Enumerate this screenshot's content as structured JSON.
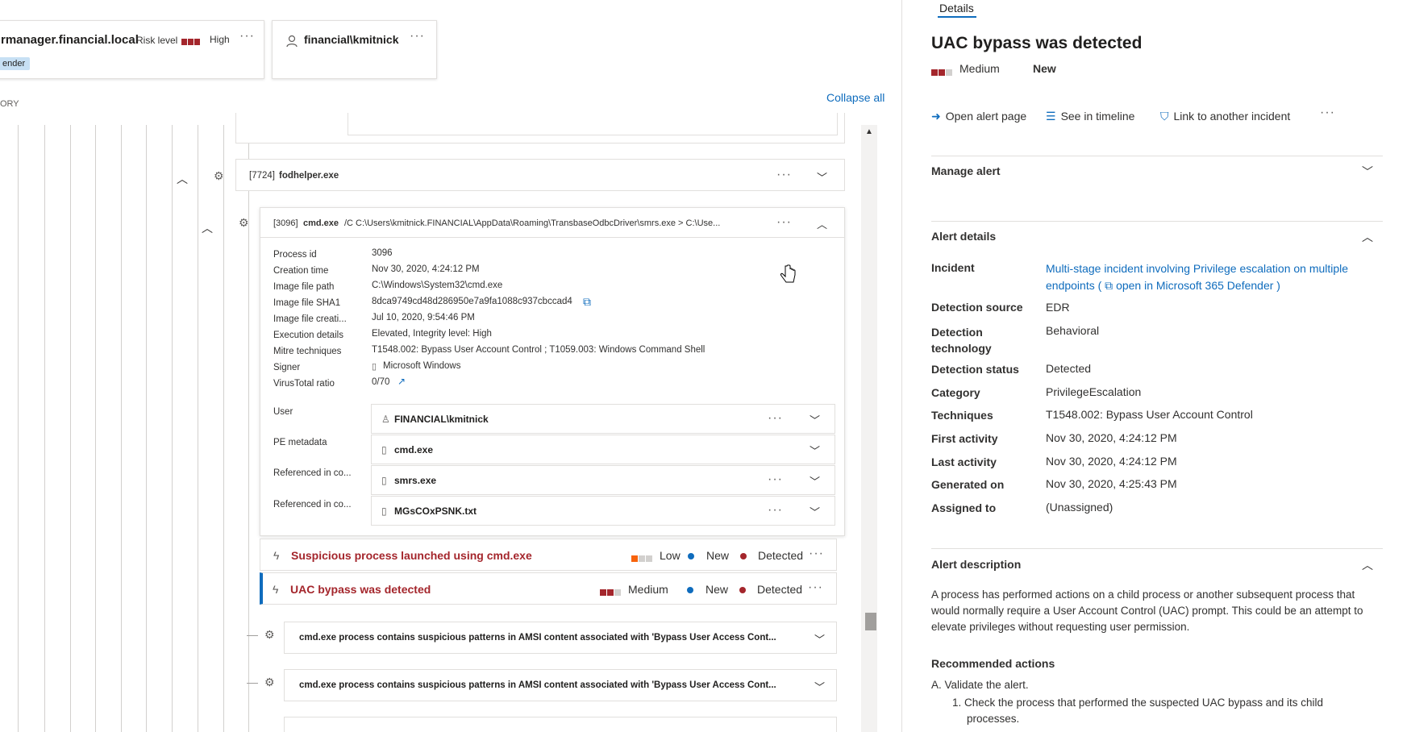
{
  "left": {
    "device_card": {
      "name": "rmanager.financial.local",
      "risk_label": "Risk level",
      "risk_value": "High",
      "tag": "ender",
      "more": "···"
    },
    "user_card": {
      "name": "financial\\kmitnick",
      "more": "···"
    },
    "section_partial": "ORY",
    "collapse_all": "Collapse all",
    "fodhelper": {
      "pid": "[7724]",
      "name": "fodhelper.exe",
      "more": "···"
    },
    "cmd_process": {
      "pid": "[3096]",
      "name": "cmd.exe",
      "args": "/C C:\\Users\\kmitnick.FINANCIAL\\AppData\\Roaming\\TransbaseOdbcDriver\\smrs.exe > C:\\Use...",
      "more": "···"
    },
    "details": [
      {
        "label": "Process id",
        "value": "3096"
      },
      {
        "label": "Creation time",
        "value": "Nov 30, 2020, 4:24:12 PM"
      },
      {
        "label": "Image file path",
        "value": "C:\\Windows\\System32\\cmd.exe"
      },
      {
        "label": "Image file SHA1",
        "value": "8dca9749cd48d286950e7a9fa1088c937cbccad4"
      },
      {
        "label": "Image file creati...",
        "value": "Jul 10, 2020, 9:54:46 PM"
      },
      {
        "label": "Execution details",
        "value": "Elevated, Integrity level: High"
      },
      {
        "label": "Mitre techniques",
        "value": "T1548.002: Bypass User Account Control ; T1059.003: Windows Command Shell"
      },
      {
        "label": "Signer",
        "value": "Microsoft Windows"
      },
      {
        "label": "VirusTotal ratio",
        "value": "0/70"
      }
    ],
    "subrows": [
      {
        "label": "User",
        "value": "FINANCIAL\\kmitnick",
        "icon": "user-icon",
        "dots": "···"
      },
      {
        "label": "PE metadata",
        "value": "cmd.exe",
        "icon": "file-icon",
        "dots": ""
      },
      {
        "label": "Referenced in co...",
        "value": "smrs.exe",
        "icon": "file-icon",
        "dots": "···"
      },
      {
        "label": "Referenced in co...",
        "value": "MGsCOxPSNK.txt",
        "icon": "file-icon",
        "dots": "···"
      }
    ],
    "alerts": [
      {
        "title": "Suspicious process launched using cmd.exe",
        "severity": "Low",
        "status": "New",
        "detection": "Detected",
        "more": "···"
      },
      {
        "title": "UAC bypass was detected",
        "severity": "Medium",
        "status": "New",
        "detection": "Detected",
        "more": "···"
      }
    ],
    "amsi_rows": [
      "cmd.exe process contains suspicious patterns in AMSI content associated with 'Bypass User Access Cont...",
      "cmd.exe process contains suspicious patterns in AMSI content associated with 'Bypass User Access Cont..."
    ],
    "colors": {
      "high": "#a4262c",
      "low": "#f7630c",
      "status_new": "#0f6cbd",
      "status_detected": "#a4262c"
    }
  },
  "right": {
    "tab": "Details",
    "title": "UAC bypass was detected",
    "severity": "Medium",
    "status": "New",
    "actions": {
      "open_alert_page": "Open alert page",
      "see_in_timeline": "See in timeline",
      "link_incident": "Link to another incident",
      "more": "···"
    },
    "manage_alert": "Manage alert",
    "alert_details": "Alert details",
    "fields": {
      "incident_label": "Incident",
      "incident_value": "Multi-stage incident involving Privilege escalation on multiple endpoints (",
      "incident_link": "open in Microsoft 365 Defender )",
      "detection_source_label": "Detection source",
      "detection_source": "EDR",
      "detection_tech_label": "Detection technology",
      "detection_tech": "Behavioral",
      "detection_status_label": "Detection status",
      "detection_status": "Detected",
      "category_label": "Category",
      "category": "PrivilegeEscalation",
      "techniques_label": "Techniques",
      "techniques": "T1548.002: Bypass User Account Control",
      "first_activity_label": "First activity",
      "first_activity": "Nov 30, 2020, 4:24:12 PM",
      "last_activity_label": "Last activity",
      "last_activity": "Nov 30, 2020, 4:24:12 PM",
      "generated_on_label": "Generated on",
      "generated_on": "Nov 30, 2020, 4:25:43 PM",
      "assigned_to_label": "Assigned to",
      "assigned_to": "(Unassigned)"
    },
    "alert_description_header": "Alert description",
    "alert_description": "A process has performed actions on a child process or another subsequent process that would normally require a User Account Control (UAC) prompt. This could be an attempt to elevate privileges without requesting user permission.",
    "recommended_header": "Recommended actions",
    "recommended_a": "A. Validate the alert.",
    "recommended_1": "1. Check the process that performed the suspected UAC bypass and its child processes."
  }
}
